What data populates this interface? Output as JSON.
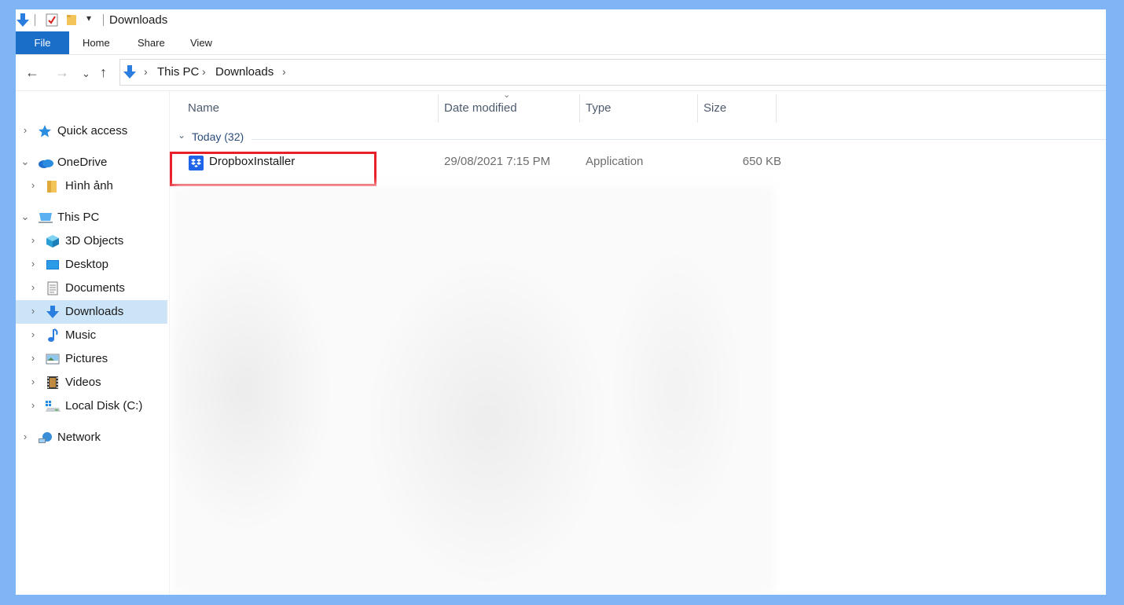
{
  "window": {
    "title": "Downloads"
  },
  "ribbon": {
    "tabs": [
      {
        "label": "File"
      },
      {
        "label": "Home"
      },
      {
        "label": "Share"
      },
      {
        "label": "View"
      }
    ]
  },
  "address_bar": {
    "segments": [
      "This PC",
      "Downloads"
    ]
  },
  "sidebar": {
    "items": [
      {
        "label": "Quick access",
        "icon": "star-icon"
      },
      {
        "label": "OneDrive",
        "icon": "cloud-icon"
      },
      {
        "label": "Hình ảnh",
        "icon": "folder-icon"
      },
      {
        "label": "This PC",
        "icon": "computer-icon"
      },
      {
        "label": "3D Objects",
        "icon": "cube-icon"
      },
      {
        "label": "Desktop",
        "icon": "desktop-icon"
      },
      {
        "label": "Documents",
        "icon": "documents-icon"
      },
      {
        "label": "Downloads",
        "icon": "download-icon",
        "selected": true
      },
      {
        "label": "Music",
        "icon": "music-icon"
      },
      {
        "label": "Pictures",
        "icon": "pictures-icon"
      },
      {
        "label": "Videos",
        "icon": "videos-icon"
      },
      {
        "label": "Local Disk (C:)",
        "icon": "disk-icon"
      },
      {
        "label": "Network",
        "icon": "network-icon"
      }
    ]
  },
  "file_list": {
    "columns": [
      "Name",
      "Date modified",
      "Type",
      "Size"
    ],
    "group": "Today (32)",
    "rows": [
      {
        "name": "DropboxInstaller",
        "date": "29/08/2021 7:15 PM",
        "type": "Application",
        "size": "650 KB",
        "icon": "dropbox-icon"
      }
    ]
  },
  "colors": {
    "frame": "#7fb5f5",
    "file_tab": "#1a6ec8",
    "selection": "#cce4f7",
    "highlight": "#e8202c"
  }
}
